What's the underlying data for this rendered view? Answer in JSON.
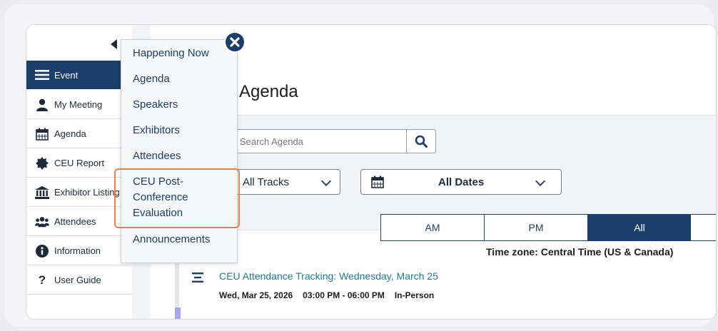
{
  "sidebar": {
    "items": [
      {
        "label": "Event",
        "icon": "menu-icon",
        "active": true
      },
      {
        "label": "My Meeting",
        "icon": "person-icon"
      },
      {
        "label": "Agenda",
        "icon": "calendar-icon"
      },
      {
        "label": "CEU Report",
        "icon": "badge-icon"
      },
      {
        "label": "Exhibitor Listing",
        "icon": "building-icon"
      },
      {
        "label": "Attendees",
        "icon": "group-icon"
      },
      {
        "label": "Information",
        "icon": "info-icon"
      },
      {
        "label": "User Guide",
        "icon": "question-icon"
      }
    ]
  },
  "main": {
    "page_title": "Agenda",
    "search": {
      "placeholder": "Search Agenda"
    },
    "tracks_select": "All Tracks",
    "dates_select": "All Dates",
    "segments": [
      "AM",
      "PM",
      "All"
    ],
    "active_segment": "All",
    "timezone": "Time zone: Central Time (US & Canada)",
    "session": {
      "title": "CEU Attendance Tracking: Wednesday, March 25",
      "date": "Wed, Mar 25, 2026",
      "time": "03:00 PM - 06:00 PM",
      "format": "In-Person"
    }
  },
  "menu": {
    "items": [
      "Happening Now",
      "Agenda",
      "Speakers",
      "Exhibitors",
      "Attendees",
      "CEU Post-\nConference\nEvaluation",
      "Announcements"
    ],
    "highlighted": "CEU Post-Conference Evaluation"
  },
  "colors": {
    "primary": "#1b3e6b",
    "highlight": "#f07e4b",
    "link": "#1f7a8f"
  }
}
